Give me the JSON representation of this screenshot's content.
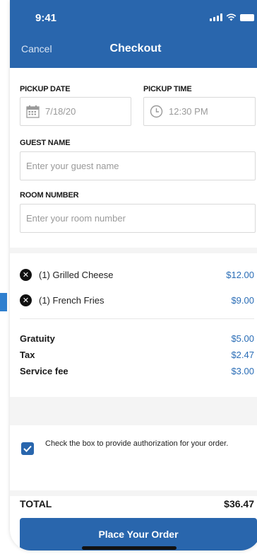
{
  "status_bar": {
    "time": "9:41"
  },
  "nav": {
    "cancel_label": "Cancel",
    "title": "Checkout"
  },
  "form": {
    "pickup_date_label": "PICKUP DATE",
    "pickup_date_value": "7/18/20",
    "pickup_time_label": "PICKUP TIME",
    "pickup_time_value": "12:30 PM",
    "guest_name_label": "GUEST NAME",
    "guest_name_placeholder": "Enter your guest name",
    "room_number_label": "ROOM NUMBER",
    "room_number_placeholder": "Enter your room number"
  },
  "items": [
    {
      "label": "(1) Grilled Cheese",
      "price": "$12.00"
    },
    {
      "label": "(1) French Fries",
      "price": "$9.00"
    }
  ],
  "fees": [
    {
      "label": "Gratuity",
      "value": "$5.00"
    },
    {
      "label": "Tax",
      "value": "$2.47"
    },
    {
      "label": "Service fee",
      "value": "$3.00"
    }
  ],
  "authorization": {
    "checked": true,
    "text": "Check the box to provide authorization for your order."
  },
  "total": {
    "label": "TOTAL",
    "value": "$36.47"
  },
  "place_order_label": "Place Your Order",
  "colors": {
    "primary": "#2966ad",
    "price": "#2a6db6",
    "accent_strip": "#2e7fcf"
  },
  "icons": [
    "signal-icon",
    "wifi-icon",
    "battery-icon",
    "calendar-icon",
    "clock-icon",
    "remove-icon",
    "check-icon"
  ]
}
